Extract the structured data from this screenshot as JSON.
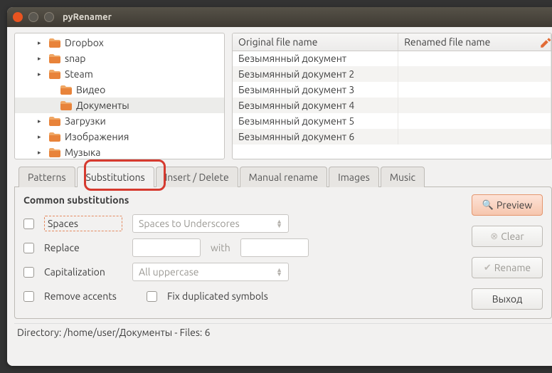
{
  "window": {
    "title": "pyRenamer"
  },
  "tree": {
    "items": [
      {
        "label": "Dropbox",
        "indent": 0,
        "expander": "▸",
        "sel": false
      },
      {
        "label": "snap",
        "indent": 0,
        "expander": "▸",
        "sel": false
      },
      {
        "label": "Steam",
        "indent": 0,
        "expander": "▸",
        "sel": false
      },
      {
        "label": "Видео",
        "indent": 1,
        "expander": "",
        "sel": false
      },
      {
        "label": "Документы",
        "indent": 1,
        "expander": "",
        "sel": true
      },
      {
        "label": "Загрузки",
        "indent": 0,
        "expander": "▸",
        "sel": false
      },
      {
        "label": "Изображения",
        "indent": 0,
        "expander": "▸",
        "sel": false
      },
      {
        "label": "Музыка",
        "indent": 0,
        "expander": "▸",
        "sel": false
      }
    ]
  },
  "file_table": {
    "cols": {
      "original": "Original file name",
      "renamed": "Renamed file name"
    },
    "rows": [
      {
        "original": "Безымянный документ",
        "renamed": ""
      },
      {
        "original": "Безымянный документ 2",
        "renamed": ""
      },
      {
        "original": "Безымянный документ 3",
        "renamed": ""
      },
      {
        "original": "Безымянный документ 4",
        "renamed": ""
      },
      {
        "original": "Безымянный документ 5",
        "renamed": ""
      },
      {
        "original": "Безымянный документ 6",
        "renamed": ""
      }
    ]
  },
  "tabs": {
    "patterns": "Patterns",
    "substitutions": "Substitutions",
    "insert_delete": "Insert / Delete",
    "manual": "Manual rename",
    "images": "Images",
    "music": "Music",
    "active": "substitutions"
  },
  "subs": {
    "title": "Common substitutions",
    "spaces_label": "Spaces",
    "spaces_combo": "Spaces to Underscores",
    "replace_label": "Replace",
    "with_label": "with",
    "cap_label": "Capitalization",
    "cap_combo": "All uppercase",
    "accents_label": "Remove accents",
    "fix_label": "Fix duplicated symbols"
  },
  "buttons": {
    "preview": "Preview",
    "clear": "Clear",
    "rename": "Rename",
    "exit": "Выход"
  },
  "status": "Directory: /home/user/Документы - Files: 6"
}
